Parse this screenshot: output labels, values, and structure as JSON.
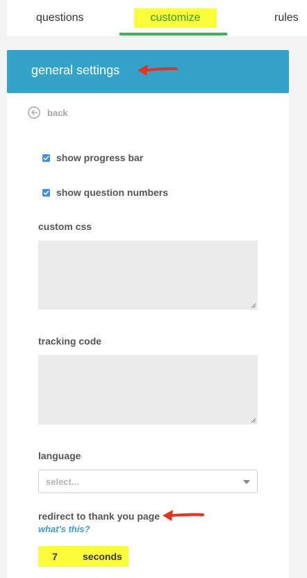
{
  "tabs": {
    "questions": "questions",
    "customize": "customize",
    "rules": "rules",
    "active": "customize"
  },
  "panel": {
    "title": "general settings",
    "back_label": "back"
  },
  "settings": {
    "show_progress_bar": {
      "label": "show progress bar",
      "checked": true
    },
    "show_question_numbers": {
      "label": "show question numbers",
      "checked": true
    },
    "custom_css": {
      "label": "custom css",
      "value": ""
    },
    "tracking_code": {
      "label": "tracking code",
      "value": ""
    },
    "language": {
      "label": "language",
      "placeholder": "select..."
    },
    "redirect": {
      "label": "redirect to thank you page",
      "help_link": "what's this?",
      "seconds_value": "7",
      "seconds_label": "seconds"
    }
  },
  "colors": {
    "header": "#33a3c9",
    "highlight": "#fbfd3a",
    "active_tab_underline": "#3cb55a",
    "link": "#3a9fcc",
    "annotation_arrow": "#e8321e"
  },
  "icons": [
    "back-arrow-icon",
    "checkmark-icon",
    "chevron-down-icon",
    "annotation-arrow-icon",
    "resize-grip-icon"
  ]
}
